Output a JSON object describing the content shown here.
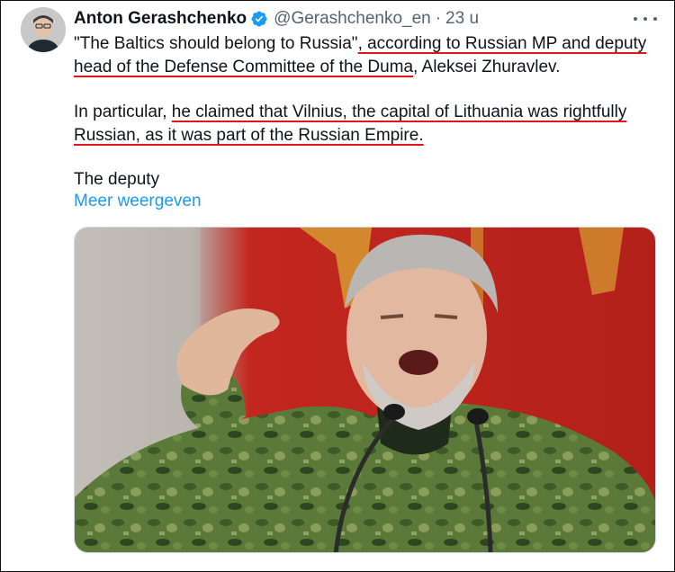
{
  "author": {
    "name": "Anton Gerashchenko",
    "handle": "@Gerashchenko_en",
    "separator": "·",
    "time": "23 u",
    "verified_color": "#1d9bf0"
  },
  "tweet": {
    "line1_a": "\"The Baltics should belong to Russia\"",
    "line1_b": ", according to Russian MP and deputy",
    "line2_a": "head of the Defense Committee of the Duma",
    "line2_b": ", Aleksei Zhuravlev.",
    "line3_a": "In particular, ",
    "line3_b": "he claimed that Vilnius, the capital of Lithuania was rightfully",
    "line4_a": "Russian, as it was part of the Russian Empire.",
    "line5": "The deputy",
    "show_more": "Meer weergeven"
  },
  "colors": {
    "underline": "#e0161d",
    "link": "#1d9bf0",
    "text": "#0f1419",
    "muted": "#536471"
  }
}
